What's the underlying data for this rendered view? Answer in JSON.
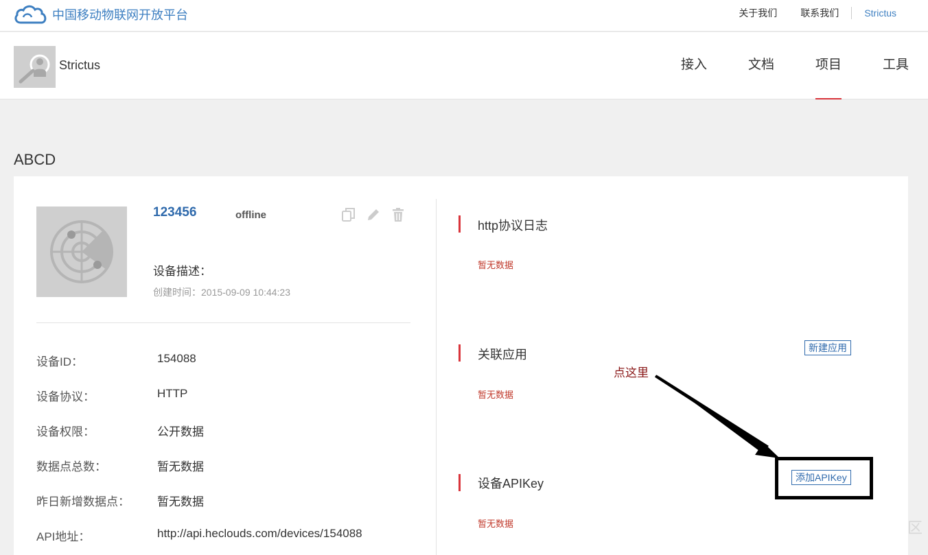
{
  "brand": {
    "text": "中国移动物联网开放平台",
    "icon": "cloud-logo-icon"
  },
  "toplinks": {
    "about": "关于我们",
    "contact": "联系我们",
    "user": "Strictus"
  },
  "header": {
    "project_name": "Strictus",
    "avatar_icon": "user-search-avatar-icon",
    "nav": [
      "接入",
      "文档",
      "项目",
      "工具"
    ],
    "active_nav": "项目"
  },
  "page_title": "ABCD",
  "device": {
    "image_icon": "radar-icon",
    "name": "123456",
    "status": "offline",
    "actions": [
      "copy-icon",
      "edit-icon",
      "delete-icon"
    ],
    "desc_label": "设备描述：",
    "created": "创建时间：2015-09-09 10:44:23",
    "props": [
      {
        "label": "设备ID：",
        "value": "154088"
      },
      {
        "label": "设备协议：",
        "value": "HTTP"
      },
      {
        "label": "设备权限：",
        "value": "公开数据"
      },
      {
        "label": "数据点总数：",
        "value": "暂无数据"
      },
      {
        "label": "昨日新增数据点：",
        "value": "暂无数据"
      },
      {
        "label": "API地址：",
        "value": "http://api.heclouds.com/devices/154088"
      }
    ]
  },
  "sections": [
    {
      "title": "http协议日志",
      "empty": "暂无数据",
      "button": ""
    },
    {
      "title": "关联应用",
      "empty": "暂无数据",
      "button": "新建应用"
    },
    {
      "title": "设备APIKey",
      "empty": "暂无数据",
      "button": "添加APIKey"
    }
  ],
  "annotation": {
    "text": "点这里"
  },
  "colors": {
    "accent": "#d9343b",
    "link": "#2f6aac",
    "brand": "#3d7fc1",
    "empty_text": "#c0392b"
  }
}
